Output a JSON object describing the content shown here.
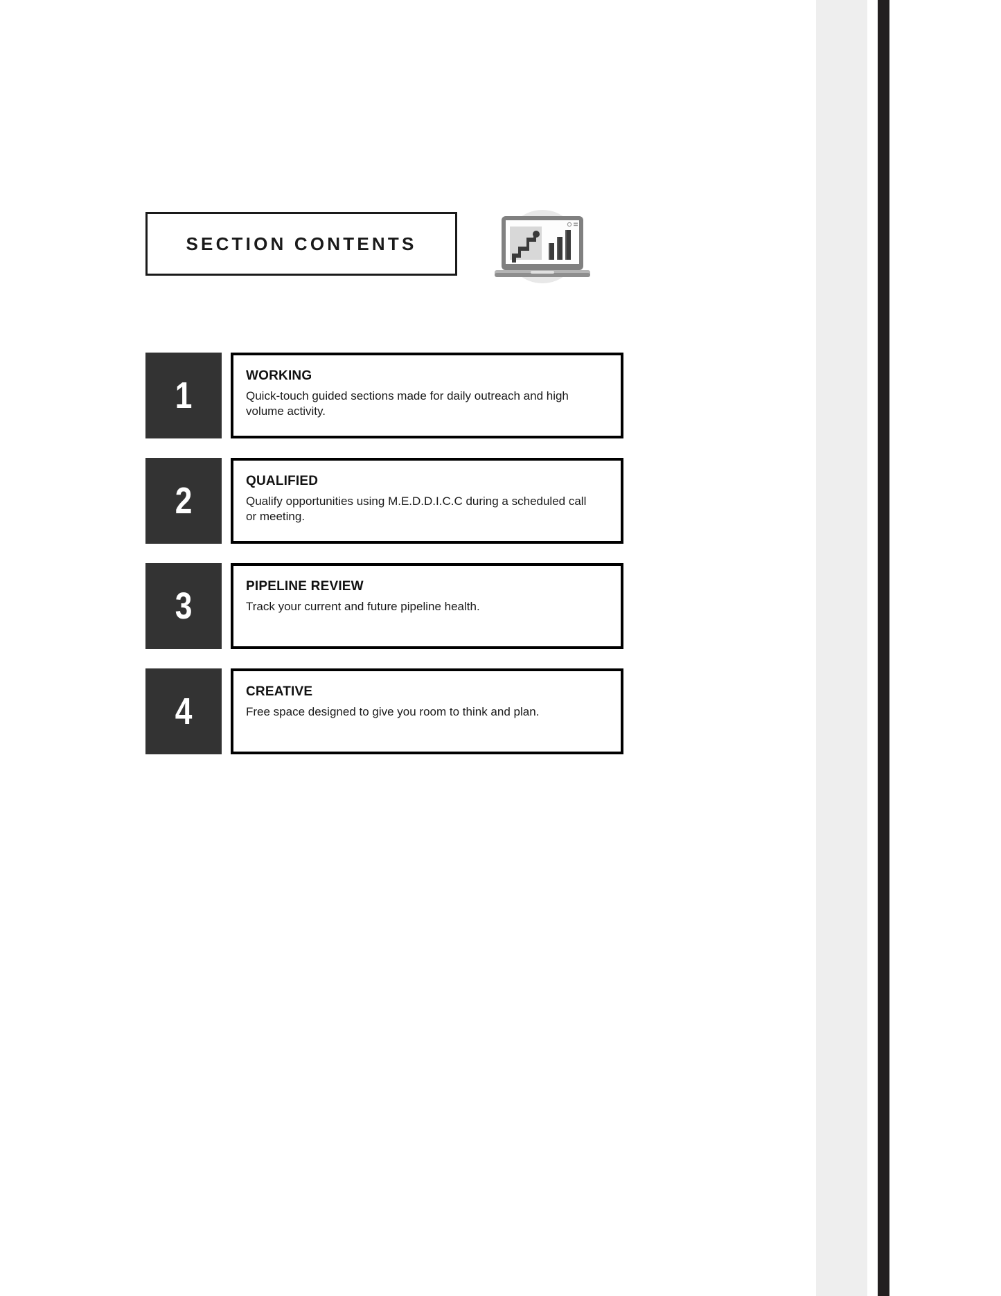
{
  "header": {
    "title": "SECTION CONTENTS",
    "icon": {
      "name": "laptop-analytics-icon",
      "description": "laptop displaying a step line chart and a bar chart",
      "colors": {
        "circle_backdrop": "#e8e8e8",
        "laptop_body": "#808080",
        "screen": "#ffffff",
        "chart_dark": "#3a3a3a",
        "chart_panel": "#d8d8d8"
      }
    }
  },
  "sections": [
    {
      "number": "1",
      "title": "WORKING",
      "description": "Quick-touch guided sections made for daily outreach and high volume activity."
    },
    {
      "number": "2",
      "title": "QUALIFIED",
      "description": "Qualify opportunities using M.E.D.D.I.C.C during a scheduled call or meeting."
    },
    {
      "number": "3",
      "title": "PIPELINE REVIEW",
      "description": "Track your current and future pipeline health."
    },
    {
      "number": "4",
      "title": "CREATIVE",
      "description": "Free space designed to give you room to think and plan."
    }
  ],
  "page_edge": {
    "grey_band_color": "#eeeeee",
    "dark_band_color": "#231f20",
    "number_box_color": "#333333",
    "border_color": "#000000",
    "background_color": "#ffffff"
  }
}
